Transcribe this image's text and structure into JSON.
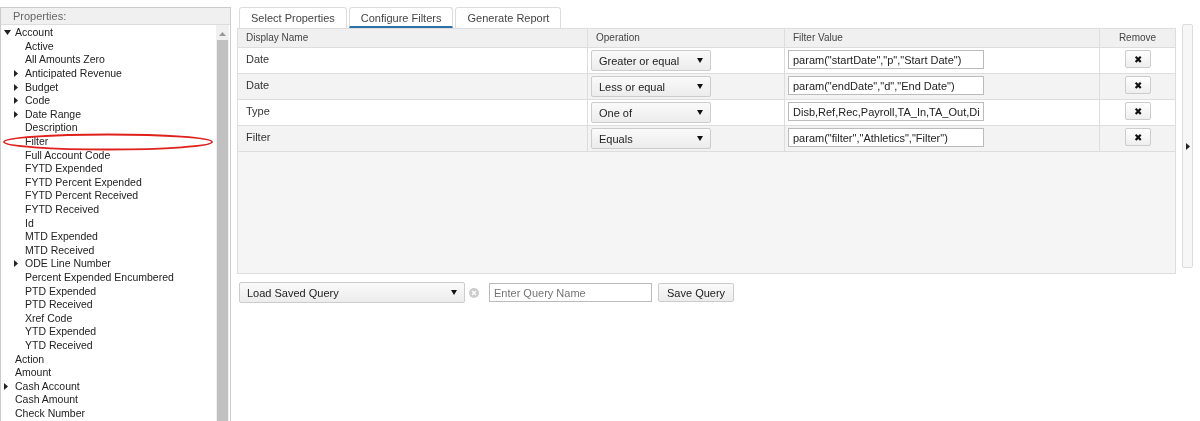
{
  "properties_panel": {
    "title": "Properties:",
    "tree": [
      {
        "label": "Account",
        "expanded": true,
        "highlighted": false,
        "children": [
          {
            "label": "Active",
            "highlighted": false
          },
          {
            "label": "All Amounts Zero",
            "highlighted": false
          },
          {
            "label": "Anticipated Revenue",
            "expanded": false,
            "highlighted": false
          },
          {
            "label": "Budget",
            "expanded": false,
            "highlighted": false
          },
          {
            "label": "Code",
            "expanded": false,
            "highlighted": false
          },
          {
            "label": "Date Range",
            "expanded": false,
            "highlighted": false
          },
          {
            "label": "Description",
            "highlighted": false
          },
          {
            "label": "Filter",
            "highlighted": true
          },
          {
            "label": "Full Account Code",
            "highlighted": false
          },
          {
            "label": "FYTD Expended",
            "highlighted": false
          },
          {
            "label": "FYTD Percent Expended",
            "highlighted": false
          },
          {
            "label": "FYTD Percent Received",
            "highlighted": false
          },
          {
            "label": "FYTD Received",
            "highlighted": false
          },
          {
            "label": "Id",
            "highlighted": false
          },
          {
            "label": "MTD Expended",
            "highlighted": false
          },
          {
            "label": "MTD Received",
            "highlighted": false
          },
          {
            "label": "ODE Line Number",
            "expanded": false,
            "highlighted": false
          },
          {
            "label": "Percent Expended Encumbered",
            "highlighted": false
          },
          {
            "label": "PTD Expended",
            "highlighted": false
          },
          {
            "label": "PTD Received",
            "highlighted": false
          },
          {
            "label": "Xref Code",
            "highlighted": false
          },
          {
            "label": "YTD Expended",
            "highlighted": false
          },
          {
            "label": "YTD Received",
            "highlighted": false
          }
        ]
      },
      {
        "label": "Action",
        "highlighted": false
      },
      {
        "label": "Amount",
        "highlighted": false
      },
      {
        "label": "Cash Account",
        "expanded": false,
        "highlighted": false
      },
      {
        "label": "Cash Amount",
        "highlighted": false
      },
      {
        "label": "Check Number",
        "highlighted": false
      }
    ]
  },
  "tabs": [
    {
      "label": "Select Properties",
      "selected": false
    },
    {
      "label": "Configure Filters",
      "selected": true
    },
    {
      "label": "Generate Report",
      "selected": false
    }
  ],
  "filters_table": {
    "columns": [
      "Display Name",
      "Operation",
      "Filter Value",
      "Remove"
    ],
    "rows": [
      {
        "display_name": "Date",
        "operation": "Greater or equal",
        "filter_value": "param(\"startDate\",\"p\",\"Start Date\")",
        "remove": "✖"
      },
      {
        "display_name": "Date",
        "operation": "Less or equal",
        "filter_value": "param(\"endDate\",\"d\",\"End Date\")",
        "remove": "✖"
      },
      {
        "display_name": "Type",
        "operation": "One of",
        "filter_value": "Disb,Ref,Rec,Payroll,TA_In,TA_Out,Di",
        "remove": "✖"
      },
      {
        "display_name": "Filter",
        "operation": "Equals",
        "filter_value": "param(\"filter\",\"Athletics\",\"Filter\")",
        "remove": "✖"
      }
    ]
  },
  "query_bar": {
    "saved_query": "Load Saved Query",
    "name_placeholder": "Enter Query Name",
    "save_button": "Save Query"
  }
}
